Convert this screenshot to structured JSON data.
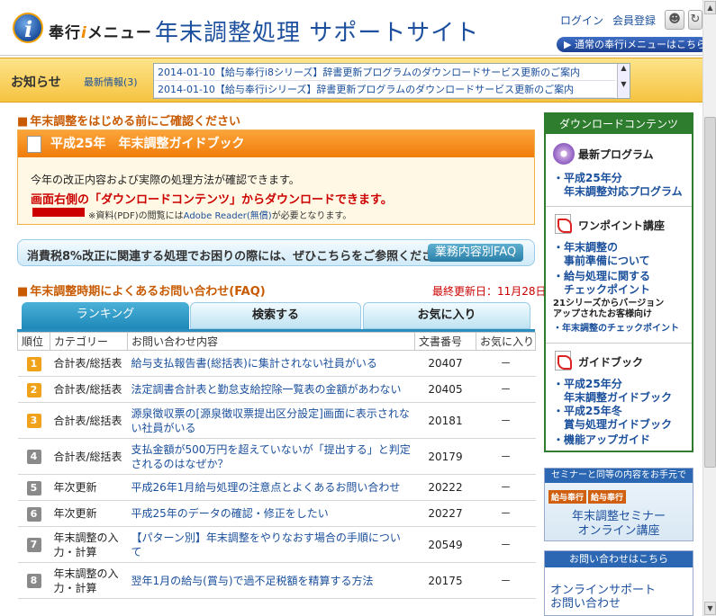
{
  "header": {
    "logo_text_a": "奉行",
    "logo_text_bang": "i",
    "logo_text_b": "メニュー",
    "site_title": "年末調整処理 サポートサイト",
    "login_label": "ログイン",
    "register_label": "会員登録",
    "switch_label": "▶ 通常の奉行iメニューはこちら"
  },
  "news": {
    "title": "お知らせ",
    "count_label": "最新情報(3)",
    "items": [
      "2014-01-10【給与奉行i8シリーズ】辞書更新プログラムのダウンロードサービス更新のご案内",
      "2014-01-10【給与奉行iシリーズ】辞書更新プログラムのダウンロードサービス更新のご案内"
    ]
  },
  "guide": {
    "section_title": "年末調整をはじめる前にご確認ください",
    "panel_title": "平成25年　年末調整ガイドブック",
    "line1": "今年の改正内容および実際の処理方法が確認できます。",
    "line2": "画面右側の「ダウンロードコンテンツ」からダウンロードできます。",
    "line3_pre": "※資料(PDF)の閲覧には",
    "line3_link": "Adobe Reader(無償)",
    "line3_post": "が必要となります。"
  },
  "faq_banner": {
    "text": "消費税8%改正に関連する処理でお困りの際には、ぜひこちらをご参照ください。",
    "button": "業務内容別FAQ"
  },
  "faq": {
    "section_title": "年末調整時期によくあるお問い合わせ(FAQ)",
    "updated": "最終更新日：11月28日",
    "tabs": [
      "ランキング",
      "検索する",
      "お気に入り"
    ],
    "columns": [
      "順位",
      "カテゴリー",
      "お問い合わせ内容",
      "文書番号",
      "お気に入り"
    ],
    "rows": [
      {
        "rank": "1",
        "category": "合計表/総括表",
        "question": "給与支払報告書(総括表)に集計されない社員がいる",
        "doc": "20407",
        "fav": "－"
      },
      {
        "rank": "2",
        "category": "合計表/総括表",
        "question": "法定調書合計表と勤怠支給控除一覧表の金額があわない",
        "doc": "20405",
        "fav": "－"
      },
      {
        "rank": "3",
        "category": "合計表/総括表",
        "question": "源泉徴収票の[源泉徴収票提出区分設定]画面に表示されない社員がいる",
        "doc": "20181",
        "fav": "－"
      },
      {
        "rank": "4",
        "category": "合計表/総括表",
        "question": "支払金額が500万円を超えていないが「提出する」と判定されるのはなぜか？",
        "doc": "20179",
        "fav": "－"
      },
      {
        "rank": "5",
        "category": "年次更新",
        "question": "平成26年1月給与処理の注意点とよくあるお問い合わせ",
        "doc": "20222",
        "fav": "－"
      },
      {
        "rank": "6",
        "category": "年次更新",
        "question": "平成25年のデータの確認・修正をしたい",
        "doc": "20227",
        "fav": "－"
      },
      {
        "rank": "7",
        "category": "年末調整の入力・計算",
        "question": "【パターン別】年末調整をやりなおす場合の手順について",
        "doc": "20549",
        "fav": "－"
      },
      {
        "rank": "8",
        "category": "年末調整の入力・計算",
        "question": "翌年1月の給与(賞与)で過不足税額を精算する方法",
        "doc": "20175",
        "fav": "－"
      }
    ]
  },
  "download": {
    "title": "ダウンロードコンテンツ",
    "latest_title": "最新プログラム",
    "latest_link_1": "・平成25年分",
    "latest_link_2": "　年末調整対応プログラム",
    "point_title": "ワンポイント講座",
    "point_link_1": "・年末調整の",
    "point_link_2": "　事前準備について",
    "point_link_3": "・給与処理に関する",
    "point_link_4": "　チェックポイント",
    "point_note_1": "21シリーズからバージョン",
    "point_note_2": "アップされたお客様向け",
    "point_note_3": "・年末調整のチェックポイント",
    "guide_title": "ガイドブック",
    "guide_link_1": "・平成25年分",
    "guide_link_2": "　年末調整ガイドブック",
    "guide_link_3": "・平成25年冬",
    "guide_link_4": "　賞与処理ガイドブック",
    "guide_link_5": "・機能アップガイド"
  },
  "seminar": {
    "head": "セミナーと同等の内容をお手元で",
    "tag1": "給与奉行",
    "tag2": "給与奉行",
    "title1": "年末調整セミナー",
    "title2": "オンライン講座"
  },
  "contact": {
    "head": "お問い合わせはこちら",
    "line1": "オンラインサポート",
    "line2": "お問い合わせ"
  },
  "colors": {
    "accent_orange": "#f07d0a",
    "brand_blue": "#1c4f9e",
    "download_green": "#2e7d2e",
    "tab_active": "#1f88b8"
  }
}
